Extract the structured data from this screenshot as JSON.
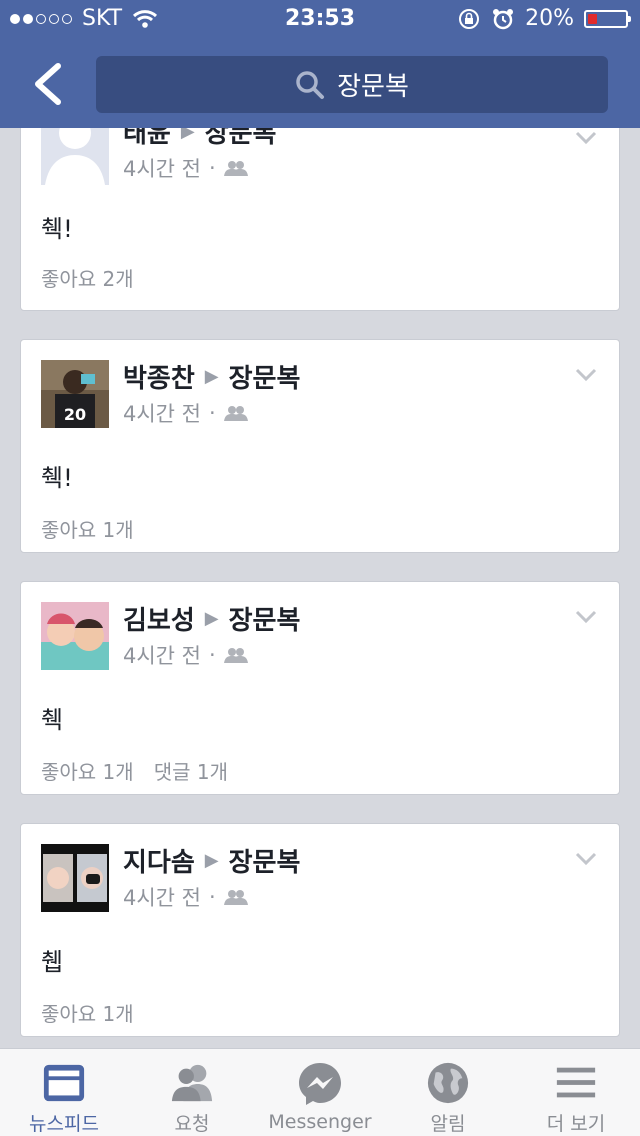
{
  "status": {
    "carrier": "SKT",
    "time": "23:53",
    "battery": "20%",
    "battery_level": 0.2,
    "signal_bars_filled": 2,
    "signal_bars_total": 5
  },
  "header": {
    "search_text": "장문복"
  },
  "posts": [
    {
      "author": "태윤",
      "target": "장문복",
      "time": "4시간 전",
      "dot": "·",
      "text": "췍!",
      "likes": "좋아요 2개",
      "comments": ""
    },
    {
      "author": "박종찬",
      "target": "장문복",
      "time": "4시간 전",
      "dot": "·",
      "text": "췍!",
      "likes": "좋아요 1개",
      "comments": ""
    },
    {
      "author": "김보성",
      "target": "장문복",
      "time": "4시간 전",
      "dot": "·",
      "text": "췍",
      "likes": "좋아요 1개",
      "comments": "댓글 1개"
    },
    {
      "author": "지다솜",
      "target": "장문복",
      "time": "4시간 전",
      "dot": "·",
      "text": "췝",
      "likes": "좋아요 1개",
      "comments": ""
    }
  ],
  "tabs": [
    {
      "label": "뉴스피드",
      "icon": "news-feed-icon",
      "active": true
    },
    {
      "label": "요청",
      "icon": "friend-requests-icon",
      "active": false
    },
    {
      "label": "Messenger",
      "icon": "messenger-icon",
      "active": false
    },
    {
      "label": "알림",
      "icon": "globe-icon",
      "active": false
    },
    {
      "label": "더 보기",
      "icon": "menu-icon",
      "active": false
    }
  ],
  "colors": {
    "brand": "#4c66a4",
    "search_bg": "#384d80",
    "feed_bg": "#d6d8de",
    "battery_low": "#e12b2b"
  }
}
